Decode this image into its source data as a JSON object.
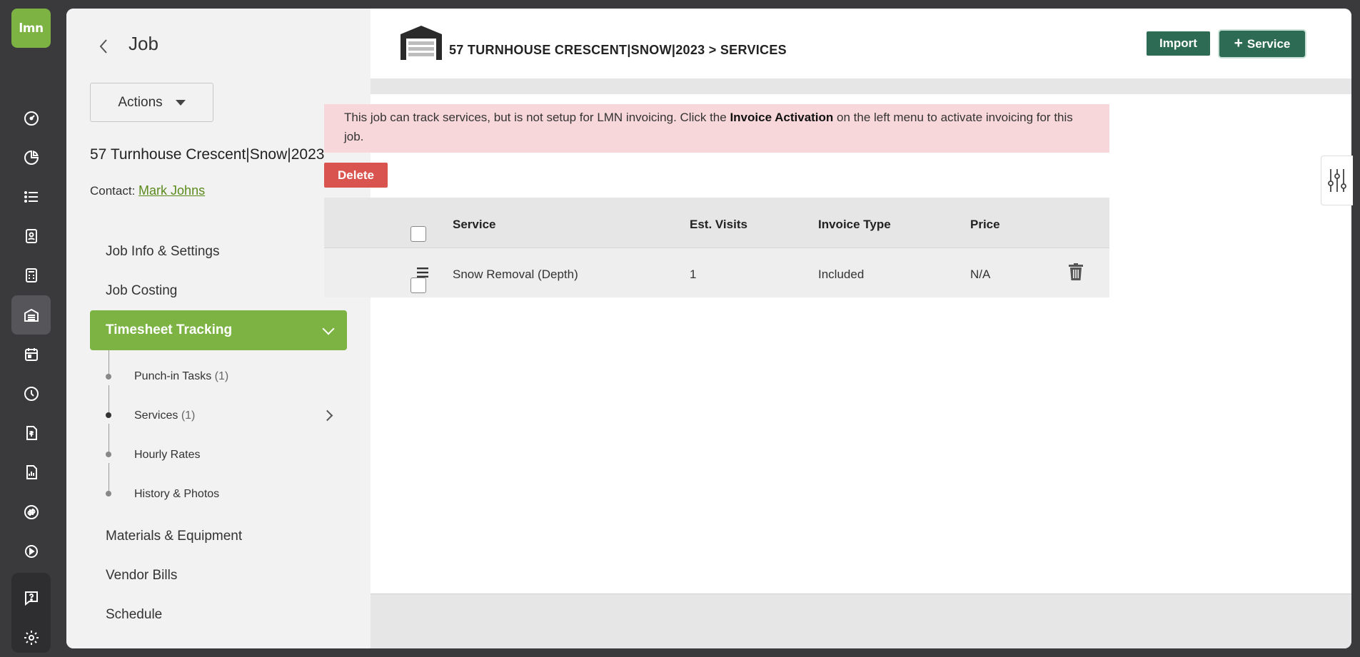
{
  "app": {
    "logo_text": "lmn"
  },
  "rail": {
    "icons": [
      "dashboard-icon",
      "pie-chart-icon",
      "list-icon",
      "contact-card-icon",
      "calculator-icon",
      "job-garage-icon",
      "calendar-icon",
      "clock-icon",
      "invoice-icon",
      "report-icon",
      "quickbooks-icon",
      "play-icon",
      "help-icon",
      "settings-icon"
    ]
  },
  "left": {
    "title": "Job",
    "actions_label": "Actions",
    "job_name": "57 Turnhouse Crescent|Snow|2023",
    "contact_label": "Contact:",
    "contact_name": "Mark Johns",
    "nav": {
      "job_info": "Job Info & Settings",
      "job_costing": "Job Costing",
      "timesheet": "Timesheet Tracking",
      "materials": "Materials & Equipment",
      "vendor_bills": "Vendor Bills",
      "schedule": "Schedule"
    },
    "sub": {
      "punch_in": "Punch-in Tasks",
      "punch_in_count": "(1)",
      "services": "Services",
      "services_count": "(1)",
      "hourly": "Hourly Rates",
      "history": "History & Photos"
    }
  },
  "header": {
    "breadcrumb": "57 TURNHOUSE CRESCENT|SNOW|2023 > SERVICES",
    "import_label": "Import",
    "service_label": "Service"
  },
  "alert": {
    "text_before": "This job can track services, but is not setup for LMN invoicing. Click the ",
    "bold": "Invoice Activation",
    "text_after": " on the left menu to activate invoicing for this job."
  },
  "delete_label": "Delete",
  "table": {
    "headers": {
      "service": "Service",
      "visits": "Est. Visits",
      "invoice_type": "Invoice Type",
      "price": "Price"
    },
    "rows": [
      {
        "service": "Snow Removal (Depth)",
        "visits": "1",
        "invoice_type": "Included",
        "price": "N/A"
      }
    ]
  }
}
